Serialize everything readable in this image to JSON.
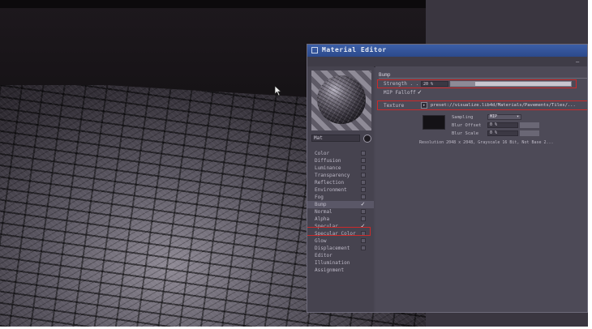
{
  "window": {
    "title": "Material Editor",
    "menu_dash": "–"
  },
  "material": {
    "name": "Mat"
  },
  "channels": [
    {
      "label": "Color",
      "checked": false
    },
    {
      "label": "Diffusion",
      "checked": false
    },
    {
      "label": "Luminance",
      "checked": false
    },
    {
      "label": "Transparency",
      "checked": false
    },
    {
      "label": "Reflection",
      "checked": false
    },
    {
      "label": "Environment",
      "checked": false
    },
    {
      "label": "Fog",
      "checked": false
    },
    {
      "label": "Bump",
      "checked": true,
      "selected": true
    },
    {
      "label": "Normal",
      "checked": false
    },
    {
      "label": "Alpha",
      "checked": false
    },
    {
      "label": "Specular",
      "checked": true
    },
    {
      "label": "Specular Color",
      "checked": false
    },
    {
      "label": "Glow",
      "checked": false
    },
    {
      "label": "Displacement",
      "checked": false
    },
    {
      "label": "Editor",
      "checked": false
    },
    {
      "label": "Illumination",
      "checked": false
    },
    {
      "label": "Assignment",
      "checked": false
    }
  ],
  "bump": {
    "section_title": "Bump",
    "strength_label": "Strength . . .",
    "strength_value": "20 %",
    "strength_fraction": 0.2,
    "mip_label": "MIP Falloff",
    "mip_check": "✓",
    "texture_label": "Texture",
    "texture_button": "▸",
    "texture_path": "preset://visualize.lib4d/Materials/Pavements/Tiles/...",
    "sampling_label": "Sampling",
    "sampling_value": "MIP",
    "blur_offset_label": "Blur Offset",
    "blur_offset_value": "0 %",
    "blur_scale_label": "Blur Scale",
    "blur_scale_value": "0 %",
    "resolution_text": "Resolution 2048 x 2048, Grayscale 16 Bit, Not Base 2..."
  }
}
